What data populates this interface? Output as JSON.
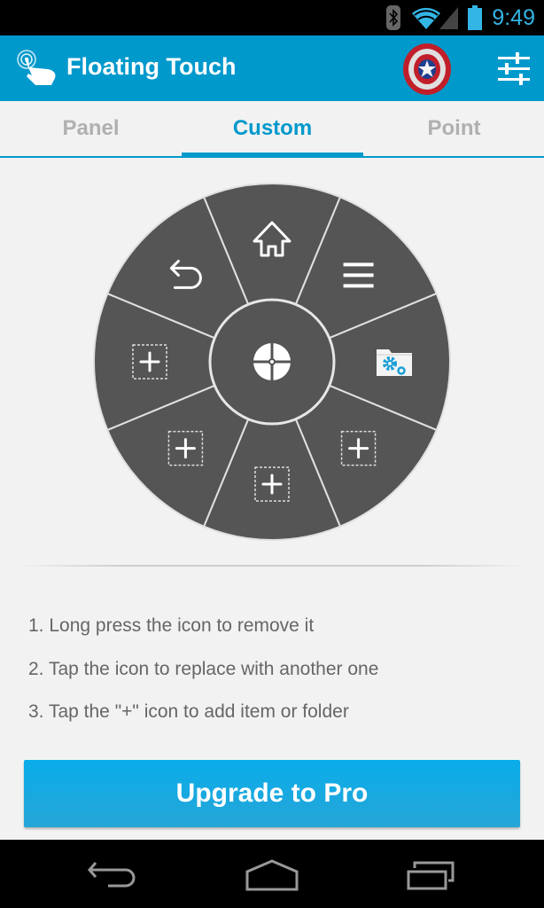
{
  "status_bar": {
    "time": "9:49",
    "icons": [
      "bluetooth-icon",
      "wifi-icon",
      "signal-icon",
      "battery-icon"
    ],
    "accent": "#33b5e5"
  },
  "action_bar": {
    "title": "Floating Touch",
    "app_icon": "touch-hand-icon",
    "theme_button_icon": "captain-america-shield-icon",
    "settings_icon": "sliders-icon",
    "color": "#0099cc"
  },
  "tabs": [
    {
      "label": "Panel",
      "active": false
    },
    {
      "label": "Custom",
      "active": true
    },
    {
      "label": "Point",
      "active": false
    }
  ],
  "wheel": {
    "center_icon": "floating-touch-center-icon",
    "sectors": [
      {
        "position": "top",
        "icon": "home-icon"
      },
      {
        "position": "top-right",
        "icon": "menu-icon"
      },
      {
        "position": "right",
        "icon": "settings-folder-icon"
      },
      {
        "position": "bottom-right",
        "icon": "add-slot-icon"
      },
      {
        "position": "bottom",
        "icon": "add-slot-icon"
      },
      {
        "position": "bottom-left",
        "icon": "add-slot-icon"
      },
      {
        "position": "left",
        "icon": "add-slot-icon"
      },
      {
        "position": "top-left",
        "icon": "back-icon"
      }
    ],
    "fill": "#555555",
    "line": "#e0e0e0"
  },
  "instructions": [
    "1. Long press the icon to remove it",
    "2. Tap the icon to replace with another one",
    "3. Tap the \"+\" icon to add item or folder"
  ],
  "upgrade_button": {
    "label": "Upgrade to Pro"
  },
  "nav_bar": {
    "buttons": [
      "back-nav-icon",
      "home-nav-icon",
      "recents-nav-icon"
    ]
  }
}
